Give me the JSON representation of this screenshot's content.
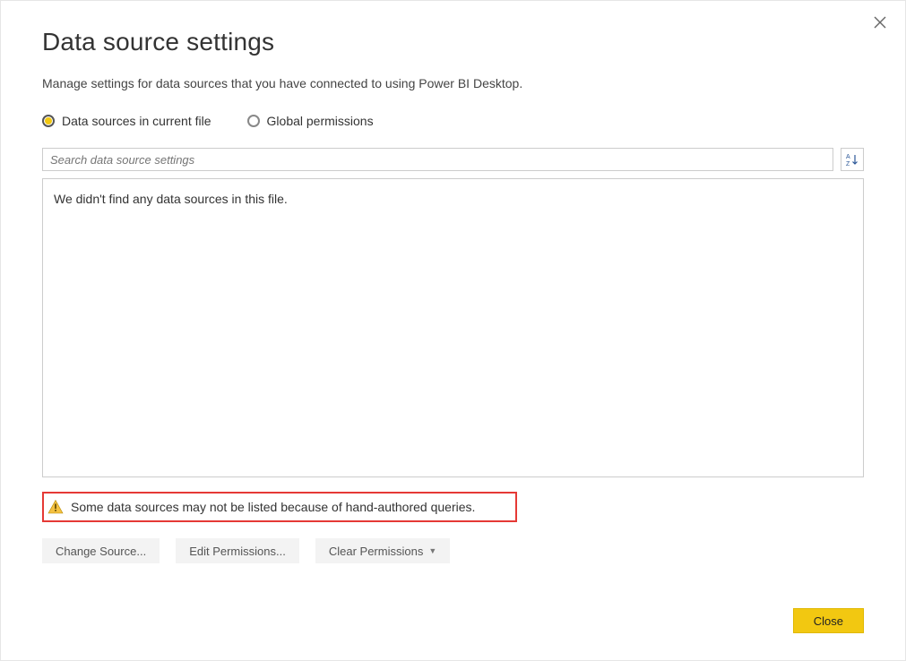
{
  "dialog": {
    "title": "Data source settings",
    "subtitle": "Manage settings for data sources that you have connected to using Power BI Desktop."
  },
  "radios": {
    "current_file": "Data sources in current file",
    "global_permissions": "Global permissions"
  },
  "search": {
    "placeholder": "Search data source settings"
  },
  "sort": {
    "label": "A↓Z"
  },
  "list": {
    "empty_message": "We didn't find any data sources in this file."
  },
  "notice": {
    "text": "Some data sources may not be listed because of hand-authored queries."
  },
  "actions": {
    "change_source": "Change Source...",
    "edit_permissions": "Edit Permissions...",
    "clear_permissions": "Clear Permissions"
  },
  "footer": {
    "close": "Close"
  }
}
